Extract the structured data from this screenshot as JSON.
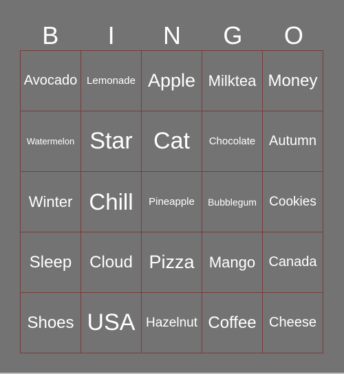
{
  "header": {
    "letters": [
      "B",
      "I",
      "N",
      "G",
      "O"
    ]
  },
  "colors": {
    "background": "#737373",
    "grid_line": "#7a3a3a",
    "text": "#ffffff"
  },
  "board": [
    [
      "Avocado",
      "Lemonade",
      "Apple",
      "Milktea",
      "Money"
    ],
    [
      "Watermelon",
      "Star",
      "Cat",
      "Chocolate",
      "Autumn"
    ],
    [
      "Winter",
      "Chill",
      "Pineapple",
      "Bubblegum",
      "Cookies"
    ],
    [
      "Sleep",
      "Cloud",
      "Pizza",
      "Mango",
      "Canada"
    ],
    [
      "Shoes",
      "USA",
      "Hazelnut",
      "Coffee",
      "Cheese"
    ]
  ]
}
